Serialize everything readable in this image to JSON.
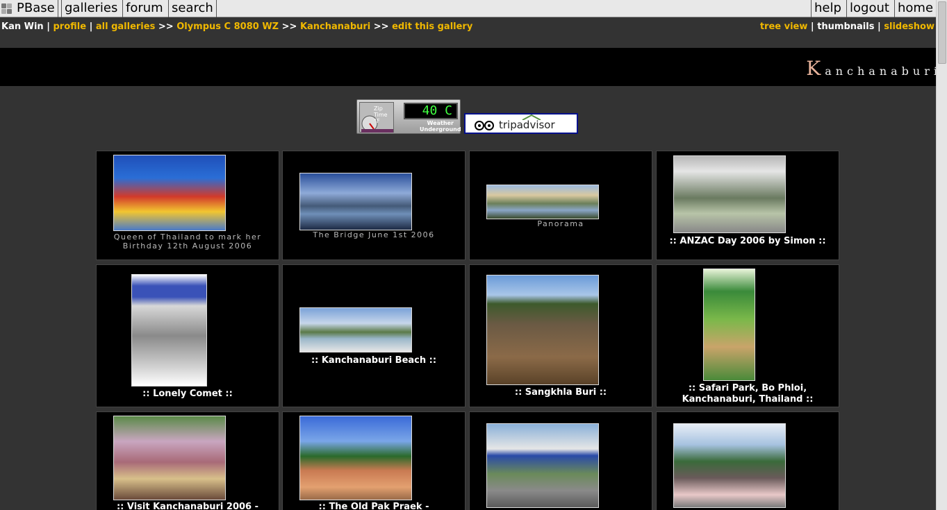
{
  "topnav": {
    "left": [
      "PBase",
      "galleries",
      "forum",
      "search"
    ],
    "right": [
      "help",
      "logout",
      "home"
    ]
  },
  "breadcrumb": {
    "user": "Kan Win",
    "sep": "|",
    "profile": "profile",
    "all_galleries": "all galleries",
    "arrow": ">>",
    "olympus": "Olympus C 8080 WZ",
    "kanchanaburi": "Kanchanaburi",
    "edit": "edit this gallery"
  },
  "views": {
    "tree": "tree view",
    "thumbnails": "thumbnails",
    "slideshow": "slideshow",
    "sep": "|"
  },
  "gallery": {
    "title_first": "K",
    "title_rest": "anchanaburi"
  },
  "weather": {
    "temp": "40 C",
    "zip_line1": "Zip",
    "zip_line2": "Time",
    "zip_line3": "°F",
    "brand1": "Weather",
    "brand2": "Underground"
  },
  "tripadvisor": {
    "label": "tripadvisor",
    "mark": "oo"
  },
  "items": [
    {
      "caption": "Queen of Thailand to mark her Birthday 12th August 2006",
      "bold": false
    },
    {
      "caption": "The Bridge June 1st 2006",
      "bold": false
    },
    {
      "caption": "Panorama",
      "bold": false
    },
    {
      "caption": ":: ANZAC Day 2006 by Simon ::",
      "bold": true
    },
    {
      "caption": ":: Lonely Comet ::",
      "bold": true
    },
    {
      "caption": ":: Kanchanaburi Beach ::",
      "bold": true
    },
    {
      "caption": ":: Sangkhla Buri ::",
      "bold": true
    },
    {
      "caption": ":: Safari Park, Bo Phloi, Kanchanaburi, Thailand ::",
      "bold": true
    },
    {
      "caption": ":: Visit Kanchanaburi 2006 -",
      "bold": true
    },
    {
      "caption": ":: The Old Pak Praek -",
      "bold": true
    },
    {
      "caption": "",
      "bold": false
    },
    {
      "caption": "",
      "bold": false
    }
  ],
  "colors": {
    "link": "#f0b800",
    "background": "#333333",
    "cell": "#000000"
  }
}
